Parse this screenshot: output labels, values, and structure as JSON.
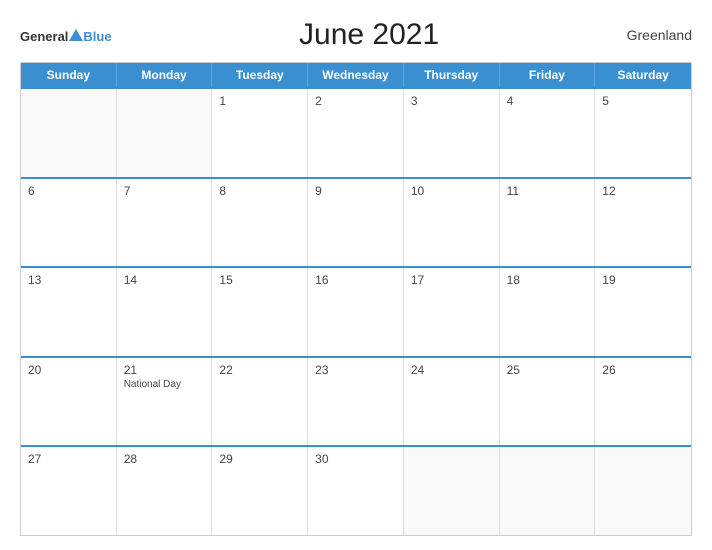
{
  "header": {
    "logo_general": "General",
    "logo_blue": "Blue",
    "title": "June 2021",
    "region": "Greenland"
  },
  "days_of_week": [
    "Sunday",
    "Monday",
    "Tuesday",
    "Wednesday",
    "Thursday",
    "Friday",
    "Saturday"
  ],
  "weeks": [
    [
      {
        "date": "",
        "empty": true
      },
      {
        "date": "",
        "empty": true
      },
      {
        "date": "1",
        "empty": false,
        "event": ""
      },
      {
        "date": "2",
        "empty": false,
        "event": ""
      },
      {
        "date": "3",
        "empty": false,
        "event": ""
      },
      {
        "date": "4",
        "empty": false,
        "event": ""
      },
      {
        "date": "5",
        "empty": false,
        "event": ""
      }
    ],
    [
      {
        "date": "6",
        "empty": false,
        "event": ""
      },
      {
        "date": "7",
        "empty": false,
        "event": ""
      },
      {
        "date": "8",
        "empty": false,
        "event": ""
      },
      {
        "date": "9",
        "empty": false,
        "event": ""
      },
      {
        "date": "10",
        "empty": false,
        "event": ""
      },
      {
        "date": "11",
        "empty": false,
        "event": ""
      },
      {
        "date": "12",
        "empty": false,
        "event": ""
      }
    ],
    [
      {
        "date": "13",
        "empty": false,
        "event": ""
      },
      {
        "date": "14",
        "empty": false,
        "event": ""
      },
      {
        "date": "15",
        "empty": false,
        "event": ""
      },
      {
        "date": "16",
        "empty": false,
        "event": ""
      },
      {
        "date": "17",
        "empty": false,
        "event": ""
      },
      {
        "date": "18",
        "empty": false,
        "event": ""
      },
      {
        "date": "19",
        "empty": false,
        "event": ""
      }
    ],
    [
      {
        "date": "20",
        "empty": false,
        "event": ""
      },
      {
        "date": "21",
        "empty": false,
        "event": "National Day"
      },
      {
        "date": "22",
        "empty": false,
        "event": ""
      },
      {
        "date": "23",
        "empty": false,
        "event": ""
      },
      {
        "date": "24",
        "empty": false,
        "event": ""
      },
      {
        "date": "25",
        "empty": false,
        "event": ""
      },
      {
        "date": "26",
        "empty": false,
        "event": ""
      }
    ],
    [
      {
        "date": "27",
        "empty": false,
        "event": ""
      },
      {
        "date": "28",
        "empty": false,
        "event": ""
      },
      {
        "date": "29",
        "empty": false,
        "event": ""
      },
      {
        "date": "30",
        "empty": false,
        "event": ""
      },
      {
        "date": "",
        "empty": true
      },
      {
        "date": "",
        "empty": true
      },
      {
        "date": "",
        "empty": true
      }
    ]
  ]
}
